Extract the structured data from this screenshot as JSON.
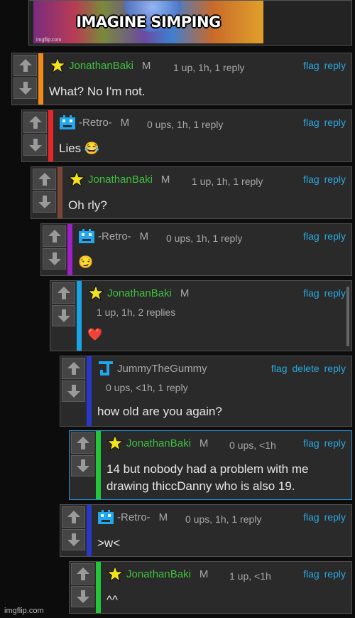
{
  "meme": {
    "caption": "IMAGINE SIMPING",
    "credit": "imgflip.com"
  },
  "actions": {
    "flag": "flag",
    "reply": "reply",
    "delete": "delete"
  },
  "colors": {
    "orange": "#f28a1a",
    "red": "#e8262a",
    "brown": "#7a4636",
    "purple": "#a020c8",
    "cyan": "#1aa4e8",
    "blue": "#2838c8",
    "green": "#22c83a",
    "link": "#2aa8e0",
    "username": "#3fbf3f"
  },
  "comments": [
    {
      "user": "JonathanBaki",
      "badge": "M",
      "meta": "1 up, 1h, 1 reply",
      "body": "What? No I'm not.",
      "avatar": "star-icon"
    },
    {
      "user": "-Retro-",
      "badge": "M",
      "meta": "0 ups, 1h, 1 reply",
      "body": "Lies 😂",
      "avatar": "retro-avatar-icon"
    },
    {
      "user": "JonathanBaki",
      "badge": "M",
      "meta": "1 up, 1h, 1 reply",
      "body": "Oh rly?",
      "avatar": "star-icon"
    },
    {
      "user": "-Retro-",
      "badge": "M",
      "meta": "0 ups, 1h, 1 reply",
      "body": "😏",
      "avatar": "retro-avatar-icon"
    },
    {
      "user": "JonathanBaki",
      "badge": "M",
      "meta": "1 up, 1h, 2 replies",
      "body": "❤️",
      "avatar": "star-icon"
    },
    {
      "user": "JummyTheGummy",
      "badge": "",
      "meta": "0 ups, <1h, 1 reply",
      "body": "how old are you again?",
      "avatar": "jummy-avatar-icon"
    },
    {
      "user": "JonathanBaki",
      "badge": "M",
      "meta": "0 ups, <1h",
      "body": "14 but nobody had a problem with me drawing thiccDanny who is also 19.",
      "avatar": "star-icon"
    },
    {
      "user": "-Retro-",
      "badge": "M",
      "meta": "0 ups, 1h, 1 reply",
      "body": ">w<",
      "avatar": "retro-avatar-icon"
    },
    {
      "user": "JonathanBaki",
      "badge": "M",
      "meta": "1 up, <1h",
      "body": "^^",
      "avatar": "star-icon"
    }
  ],
  "footer_credit": "imgflip.com"
}
